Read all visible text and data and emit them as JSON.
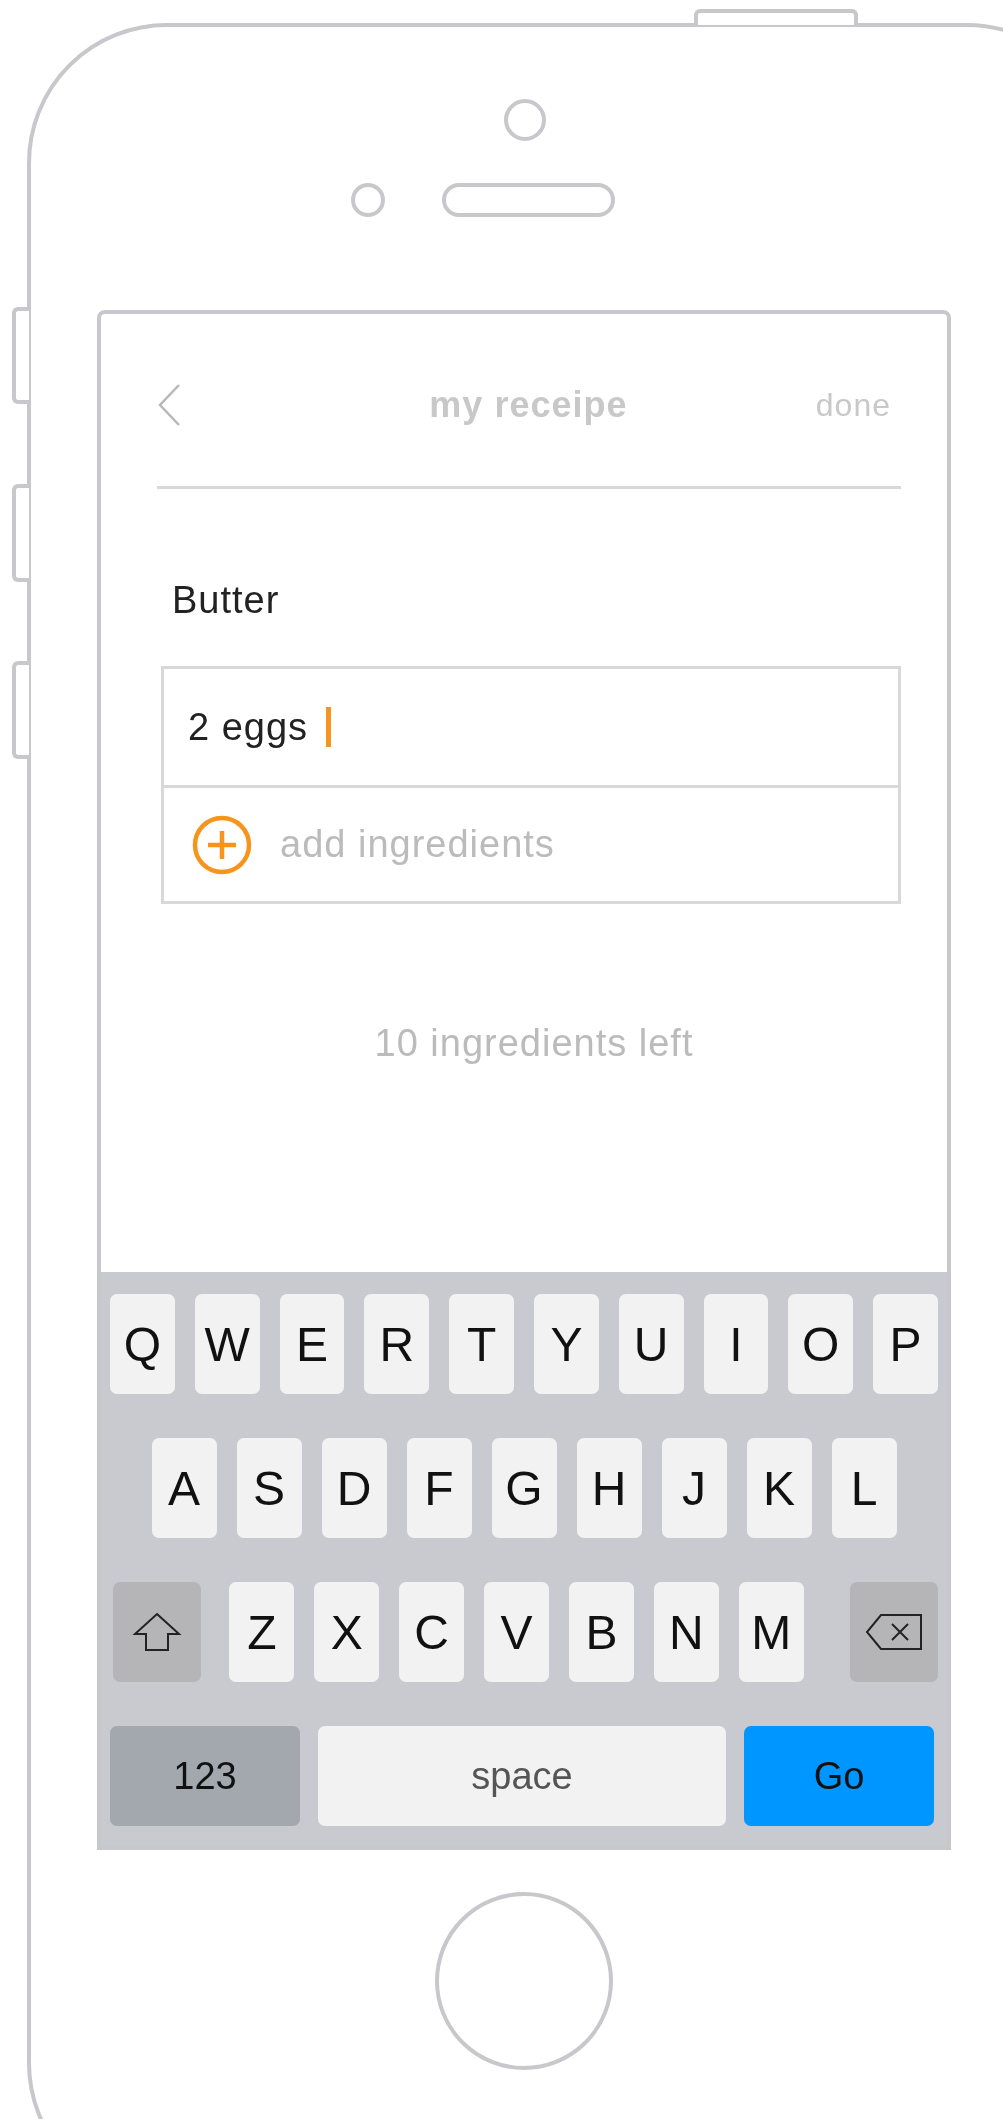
{
  "header": {
    "title": "my receipe",
    "action": "done"
  },
  "ingredient_label": "Butter",
  "ingredient_input": {
    "value": "2 eggs",
    "focused": true
  },
  "add_row": {
    "placeholder": "add ingredients"
  },
  "remaining": "10 ingredients left",
  "keyboard": {
    "rows": [
      [
        {
          "kind": "letter",
          "label": "Q"
        },
        {
          "kind": "letter",
          "label": "W"
        },
        {
          "kind": "letter",
          "label": "E"
        },
        {
          "kind": "letter",
          "label": "R"
        },
        {
          "kind": "letter",
          "label": "T"
        },
        {
          "kind": "letter",
          "label": "Y"
        },
        {
          "kind": "letter",
          "label": "U"
        },
        {
          "kind": "letter",
          "label": "I"
        },
        {
          "kind": "letter",
          "label": "O"
        },
        {
          "kind": "letter",
          "label": "P"
        }
      ],
      [
        {
          "kind": "letter",
          "label": "A"
        },
        {
          "kind": "letter",
          "label": "S"
        },
        {
          "kind": "letter",
          "label": "D"
        },
        {
          "kind": "letter",
          "label": "F"
        },
        {
          "kind": "letter",
          "label": "G"
        },
        {
          "kind": "letter",
          "label": "H"
        },
        {
          "kind": "letter",
          "label": "J"
        },
        {
          "kind": "letter",
          "label": "K"
        },
        {
          "kind": "letter",
          "label": "L"
        }
      ],
      [
        {
          "kind": "shift"
        },
        {
          "kind": "letter",
          "label": "Z"
        },
        {
          "kind": "letter",
          "label": "X"
        },
        {
          "kind": "letter",
          "label": "C"
        },
        {
          "kind": "letter",
          "label": "V"
        },
        {
          "kind": "letter",
          "label": "B"
        },
        {
          "kind": "letter",
          "label": "N"
        },
        {
          "kind": "letter",
          "label": "M"
        },
        {
          "kind": "delete"
        }
      ]
    ],
    "bottom_bar": {
      "numbers_key": "123",
      "space_key": "space",
      "go_key": "Go"
    }
  }
}
